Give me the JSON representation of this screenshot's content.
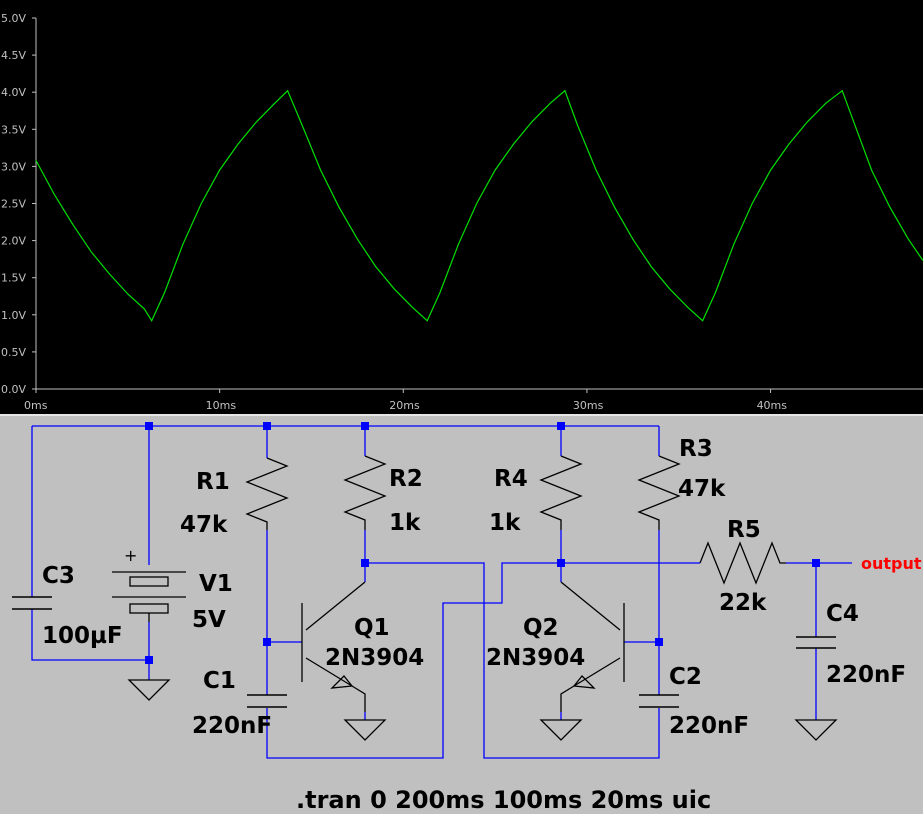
{
  "colors": {
    "plot_background": "#000000",
    "trace": "#00e000",
    "axis_text": "#c0c0c0",
    "schematic_background": "#c0c0c0",
    "wire": "#0000ff",
    "junction": "#0000ff",
    "output_label": "#ff0000"
  },
  "chart_data": {
    "type": "line",
    "x_unit": "ms",
    "y_unit": "V",
    "xlim": [
      0,
      48.3
    ],
    "ylim": [
      0,
      5.0
    ],
    "x_ticks": [
      0,
      10,
      20,
      30,
      40
    ],
    "x_tick_labels": [
      "0ms",
      "10ms",
      "20ms",
      "30ms",
      "40ms"
    ],
    "y_ticks": [
      5.0,
      4.5,
      4.0,
      3.5,
      3.0,
      2.5,
      2.0,
      1.5,
      1.0,
      0.5,
      0.0
    ],
    "y_tick_labels": [
      "5.0V",
      "4.5V",
      "4.0V",
      "3.5V",
      "3.0V",
      "2.5V",
      "2.0V",
      "1.5V",
      "1.0V",
      "0.5V",
      "0.0V"
    ],
    "grid": false,
    "series": [
      {
        "x": [
          0,
          1.0,
          2.0,
          3.0,
          4.0,
          5.0,
          5.9,
          6.3,
          7.0,
          8.0,
          9.0,
          10.0,
          11.0,
          12.0,
          13.0,
          13.7,
          14.5,
          15.5,
          16.5,
          17.5,
          18.5,
          19.5,
          20.5,
          21.3,
          22.0,
          23.0,
          24.0,
          25.0,
          26.0,
          27.0,
          28.0,
          28.8,
          29.5,
          30.5,
          31.5,
          32.5,
          33.5,
          34.5,
          35.5,
          36.3,
          37.0,
          38.0,
          39.0,
          40.0,
          41.0,
          42.0,
          43.0,
          43.9,
          44.6,
          45.5,
          46.5,
          47.5,
          48.3
        ],
        "y": [
          3.08,
          2.62,
          2.22,
          1.85,
          1.55,
          1.28,
          1.08,
          0.92,
          1.3,
          1.95,
          2.5,
          2.95,
          3.3,
          3.6,
          3.85,
          4.02,
          3.55,
          2.95,
          2.45,
          2.02,
          1.65,
          1.35,
          1.1,
          0.92,
          1.3,
          1.95,
          2.5,
          2.95,
          3.3,
          3.6,
          3.85,
          4.02,
          3.55,
          2.95,
          2.45,
          2.02,
          1.65,
          1.35,
          1.1,
          0.92,
          1.3,
          1.95,
          2.5,
          2.95,
          3.3,
          3.6,
          3.85,
          4.02,
          3.55,
          2.95,
          2.45,
          2.02,
          1.73
        ]
      }
    ]
  },
  "schematic": {
    "labels": {
      "r1_name": "R1",
      "r1_value": "47k",
      "r2_name": "R2",
      "r2_value": "1k",
      "r4_name": "R4",
      "r4_value": "1k",
      "r3_name": "R3",
      "r3_value": "47k",
      "r5_name": "R5",
      "r5_value": "22k",
      "q1_name": "Q1",
      "q1_model": "2N3904",
      "q2_name": "Q2",
      "q2_model": "2N3904",
      "c1_name": "C1",
      "c1_value": "220nF",
      "c2_name": "C2",
      "c2_value": "220nF",
      "c3_name": "C3",
      "c3_value": "100µF",
      "c4_name": "C4",
      "c4_value": "220nF",
      "v1_name": "V1",
      "v1_value": "5V",
      "v1_plus": "+",
      "output_net": "output"
    },
    "spice_directive": ".tran 0 200ms 100ms 20ms uic"
  }
}
